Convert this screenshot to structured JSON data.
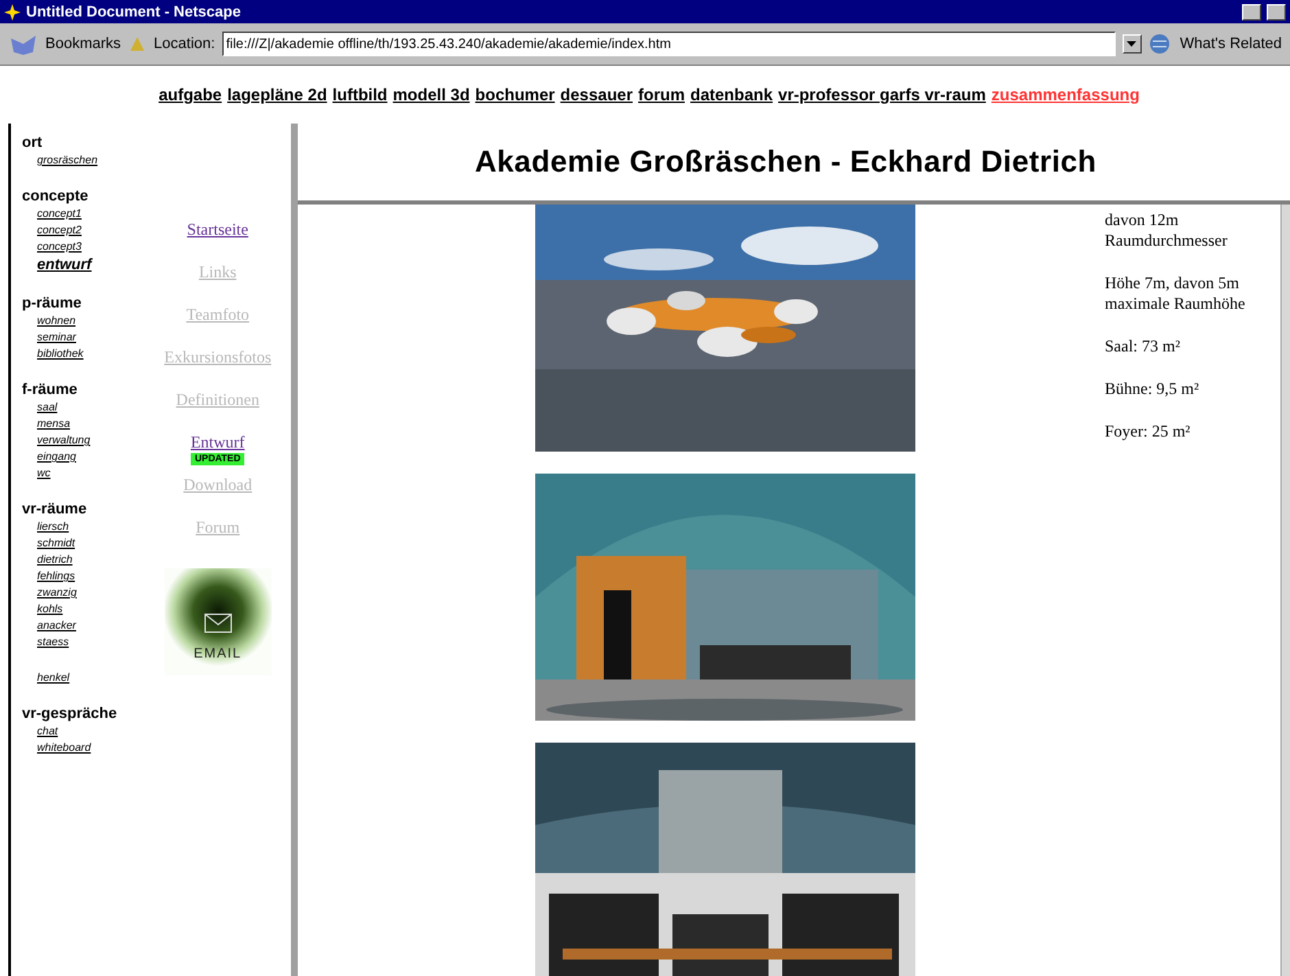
{
  "window": {
    "title": "Untitled Document - Netscape"
  },
  "toolbar": {
    "bookmarks": "Bookmarks",
    "location_label": "Location:",
    "location": "file:///Z|/akademie offline/th/193.25.43.240/akademie/akademie/index.htm",
    "related": "What's Related"
  },
  "top_nav": [
    {
      "label": "aufgabe",
      "highlighted": false
    },
    {
      "label": "lagepläne 2d",
      "highlighted": false
    },
    {
      "label": "luftbild",
      "highlighted": false
    },
    {
      "label": "modell 3d",
      "highlighted": false
    },
    {
      "label": "bochumer",
      "highlighted": false
    },
    {
      "label": "dessauer",
      "highlighted": false
    },
    {
      "label": "forum",
      "highlighted": false
    },
    {
      "label": "datenbank",
      "highlighted": false
    },
    {
      "label": "vr-professor garfs vr-raum",
      "highlighted": false
    },
    {
      "label": "zusammenfassung",
      "highlighted": true
    }
  ],
  "sidebar": {
    "groups": [
      {
        "title": "ort",
        "items": [
          {
            "label": "grosräschen",
            "selected": false
          }
        ]
      },
      {
        "title": "concepte",
        "items": [
          {
            "label": "concept1",
            "selected": false
          },
          {
            "label": "concept2",
            "selected": false
          },
          {
            "label": "concept3",
            "selected": false
          },
          {
            "label": "entwurf",
            "selected": true
          }
        ]
      },
      {
        "title": "p-räume",
        "items": [
          {
            "label": "wohnen",
            "selected": false
          },
          {
            "label": "seminar",
            "selected": false
          },
          {
            "label": "bibliothek",
            "selected": false
          }
        ]
      },
      {
        "title": "f-räume",
        "items": [
          {
            "label": "saal",
            "selected": false
          },
          {
            "label": "mensa",
            "selected": false
          },
          {
            "label": "verwaltung",
            "selected": false
          },
          {
            "label": "eingang",
            "selected": false
          },
          {
            "label": "wc",
            "selected": false
          }
        ]
      },
      {
        "title": "vr-räume",
        "items": [
          {
            "label": "liersch",
            "selected": false
          },
          {
            "label": "schmidt",
            "selected": false
          },
          {
            "label": "dietrich",
            "selected": false
          },
          {
            "label": "fehlings",
            "selected": false
          },
          {
            "label": "zwanzig",
            "selected": false
          },
          {
            "label": "kohls",
            "selected": false
          },
          {
            "label": "anacker",
            "selected": false
          },
          {
            "label": "staess",
            "selected": false
          },
          {
            "label": "henkel",
            "selected": false
          }
        ]
      },
      {
        "title": "vr-gespräche",
        "items": [
          {
            "label": "chat",
            "selected": false
          },
          {
            "label": "whiteboard",
            "selected": false
          }
        ]
      }
    ]
  },
  "links": [
    {
      "label": "Startseite",
      "active": true
    },
    {
      "label": "Links",
      "active": false
    },
    {
      "label": "Teamfoto",
      "active": false
    },
    {
      "label": "Exkursionsfotos",
      "active": false
    },
    {
      "label": "Definitionen",
      "active": false
    },
    {
      "label": "Entwurf",
      "active": true,
      "badge": "UPDATED"
    },
    {
      "label": "Download",
      "active": false
    },
    {
      "label": "Forum",
      "active": false
    }
  ],
  "email": {
    "label": "EMAIL"
  },
  "header": {
    "title": "Akademie Großräschen - Eckhard Dietrich"
  },
  "content": {
    "pictures": [
      {
        "kind": "picture"
      },
      {
        "kind": "picture"
      },
      {
        "kind": "picture"
      }
    ],
    "facts": [
      "davon 12m Raumdurchmesser",
      "Höhe 7m, davon 5m maximale Raumhöhe",
      "Saal: 73 m²",
      "Bühne: 9,5 m²",
      "Foyer: 25 m²"
    ]
  }
}
